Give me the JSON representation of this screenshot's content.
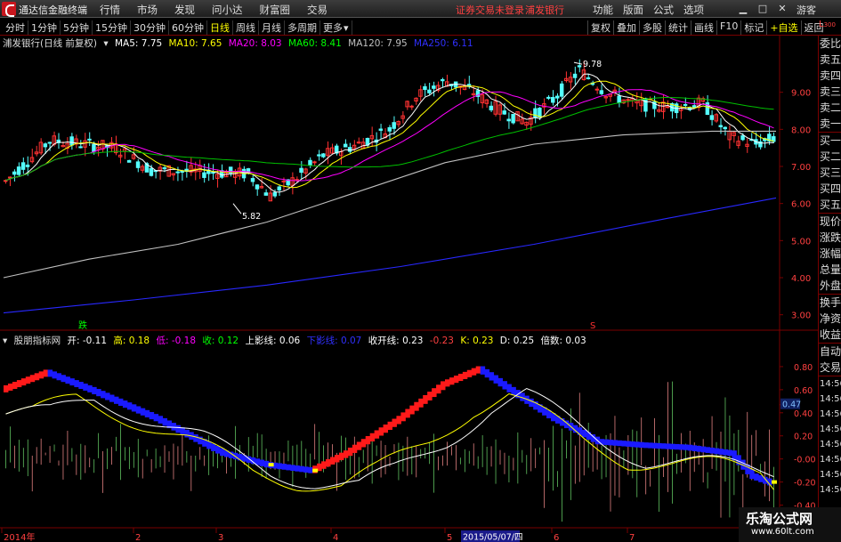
{
  "titlebar": {
    "app_title": "通达信金融终端",
    "menu": [
      "行情",
      "市场",
      "发现",
      "问小达",
      "财富圈",
      "交易"
    ],
    "login_warning": "证券交易未登录",
    "stock_title": "浦发银行",
    "right_menu": [
      "功能",
      "版面",
      "公式",
      "选项"
    ],
    "window_buttons": [
      "▁",
      "□",
      "✕"
    ],
    "guest_label": "游客"
  },
  "toolbar": {
    "periods": [
      "分时",
      "1分钟",
      "5分钟",
      "15分钟",
      "30分钟",
      "60分钟",
      "日线",
      "周线",
      "月线",
      "多周期",
      "更多"
    ],
    "active_period": "日线",
    "tools": [
      "复权",
      "叠加",
      "多股",
      "统计",
      "画线",
      "F10",
      "标记",
      "+自选",
      "返回"
    ]
  },
  "main_legend": {
    "title": "浦发银行(日线 前复权)",
    "ma": [
      {
        "label": "MA5: 7.75",
        "color": "#ffffff"
      },
      {
        "label": "MA10: 7.65",
        "color": "#ffff00"
      },
      {
        "label": "MA20: 8.03",
        "color": "#ff00ff"
      },
      {
        "label": "MA60: 8.41",
        "color": "#00ff00"
      },
      {
        "label": "MA120: 7.95",
        "color": "#c0c0c0"
      },
      {
        "label": "MA250: 6.11",
        "color": "#3030ff"
      }
    ]
  },
  "price_axis": {
    "labels": [
      "9.00",
      "8.00",
      "7.00",
      "6.00",
      "5.00",
      "4.00",
      "3.00"
    ],
    "high_label": "9.78",
    "low_label": "5.82"
  },
  "markers": {
    "fall": "跌",
    "s": "S"
  },
  "indicator_legend": {
    "name": "股朋指标网",
    "items": [
      {
        "label": "开: -0.11",
        "color": "#ffffff"
      },
      {
        "label": "高: 0.18",
        "color": "#ffff00"
      },
      {
        "label": "低: -0.18",
        "color": "#ff00ff"
      },
      {
        "label": "收: 0.12",
        "color": "#00ff00"
      },
      {
        "label": "上影线: 0.06",
        "color": "#ffffff"
      },
      {
        "label": "下影线: 0.07",
        "color": "#3030ff"
      },
      {
        "label": "收开线: 0.23",
        "color": "#ffffff"
      },
      {
        "label": "-0.23",
        "color": "#ff4040"
      },
      {
        "label": "K: 0.23",
        "color": "#ffff00"
      },
      {
        "label": "D: 0.25",
        "color": "#ffffff"
      },
      {
        "label": "倍数: 0.03",
        "color": "#ffffff"
      }
    ]
  },
  "indicator_axis": {
    "labels": [
      "0.80",
      "0.60",
      "0.47",
      "0.40",
      "0.20",
      "-0.00",
      "-0.20",
      "-0.40"
    ],
    "highlight": "0.47"
  },
  "date_axis": {
    "labels": [
      "2014年",
      "2",
      "3",
      "4",
      "5",
      "6",
      "7"
    ],
    "cursor_date": "2015/05/07/四"
  },
  "side_panel": {
    "top_label": "L",
    "top_sub": "300",
    "items1": [
      "委比",
      "卖五",
      "卖四",
      "卖三",
      "卖二",
      "卖一"
    ],
    "items2": [
      "买一",
      "买二",
      "买三",
      "买四",
      "买五"
    ],
    "items3": [
      "现价",
      "涨跌",
      "涨幅",
      "总量",
      "外盘"
    ],
    "items4": [
      "换手",
      "净资",
      "收益"
    ],
    "items5": [
      "自动",
      "交易"
    ],
    "time_labels": [
      "14:56",
      "14:56",
      "14:56",
      "14:56",
      "14:56",
      "14:56",
      "14:56",
      "14:56"
    ]
  },
  "watermark": {
    "title": "乐淘公式网",
    "url": "www.60lt.com"
  },
  "colors": {
    "up": "#ff3232",
    "down": "#54ffff",
    "grid": "#7a0000",
    "axis_text": "#ff4040"
  }
}
